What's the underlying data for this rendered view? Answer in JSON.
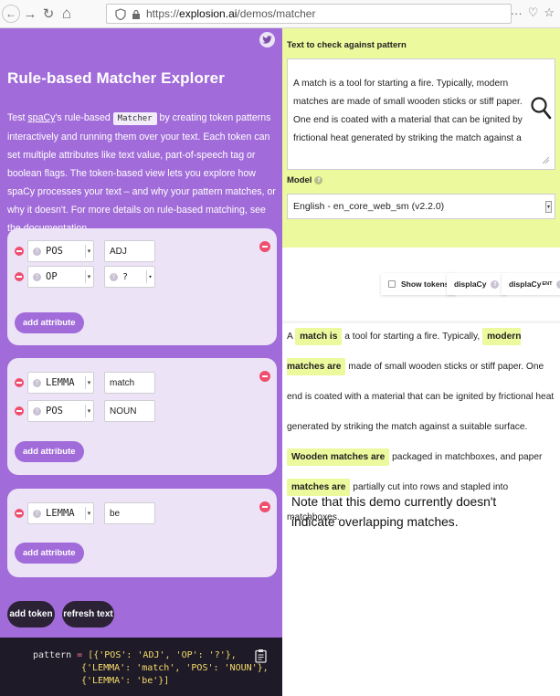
{
  "browser": {
    "back_glyph": "←",
    "forward_glyph": "→",
    "reload_glyph": "↻",
    "home_glyph": "⌂",
    "url_prefix": "https://",
    "url_domain": "explosion.ai",
    "url_path": "/demos/matcher",
    "menu_glyph": "···",
    "pocket_glyph": "♡",
    "star_glyph": "☆"
  },
  "left": {
    "title": "Rule-based Matcher Explorer",
    "intro_1": "Test ",
    "intro_spacy": "spaCy",
    "intro_2": "'s rule-based ",
    "intro_code": "Matcher",
    "intro_3": " by creating token patterns interactively and running them over your text. Each token can set multiple attributes like text value, part-of-speech tag or boolean flags. The token-based view lets you explore how spaCy processes your text – and why your pattern matches, or why it doesn't. For more details on rule-based matching, see the ",
    "intro_link": "documentation",
    "intro_4": ".",
    "tokens": [
      {
        "rows": [
          {
            "attr": "POS",
            "value": "ADJ"
          },
          {
            "attr": "OP",
            "value": "?"
          }
        ]
      },
      {
        "rows": [
          {
            "attr": "LEMMA",
            "value": "match"
          },
          {
            "attr": "POS",
            "value": "NOUN"
          }
        ]
      },
      {
        "rows": [
          {
            "attr": "LEMMA",
            "value": "be"
          }
        ]
      }
    ],
    "add_attribute": "add attribute",
    "add_token": "add token",
    "refresh_text": "refresh text",
    "code": {
      "var": "pattern",
      "eq": " = ",
      "l1": "[{'POS': 'ADJ', 'OP': '?'},",
      "l2": "{'LEMMA': 'match', 'POS': 'NOUN'},",
      "l3": "{'LEMMA': 'be'}]"
    }
  },
  "right": {
    "text_label": "Text to check against pattern",
    "text_value": "A match is a tool for starting a fire. Typically, modern matches are made of small wooden sticks or stiff paper. One end is coated with a material that can be ignited by frictional heat generated by striking the match against a suitable surface. Wooden matches are packaged",
    "model_label": "Model",
    "model_value": "English - en_core_web_sm (v2.2.0)",
    "tab_show_tokens": "Show tokens",
    "tab_displacy": "displaCy",
    "tab_displacy_ent": "displaCy",
    "tab_ent_sup": "ENT",
    "result": {
      "s1": "A ",
      "m1": "match is",
      "s2": " a tool for starting a fire. Typically, ",
      "m2": "modern matches are",
      "s3": " made of small wooden sticks or stiff paper. One end is coated with a material that can be ignited by frictional heat generated by striking the match against a suitable surface. ",
      "m3": "Wooden matches are",
      "s4": " packaged in matchboxes, and paper ",
      "m4": "matches are",
      "s5": " partially cut into rows and stapled into matchboxes."
    }
  },
  "note": "Note that this demo currently doesn't indicate overlapping matches.",
  "colors": {
    "purple": "#a16bd9",
    "card": "#ece3f7",
    "highlight": "#ecf99c",
    "remove": "#ef4f6e",
    "dark": "#2b2236"
  }
}
